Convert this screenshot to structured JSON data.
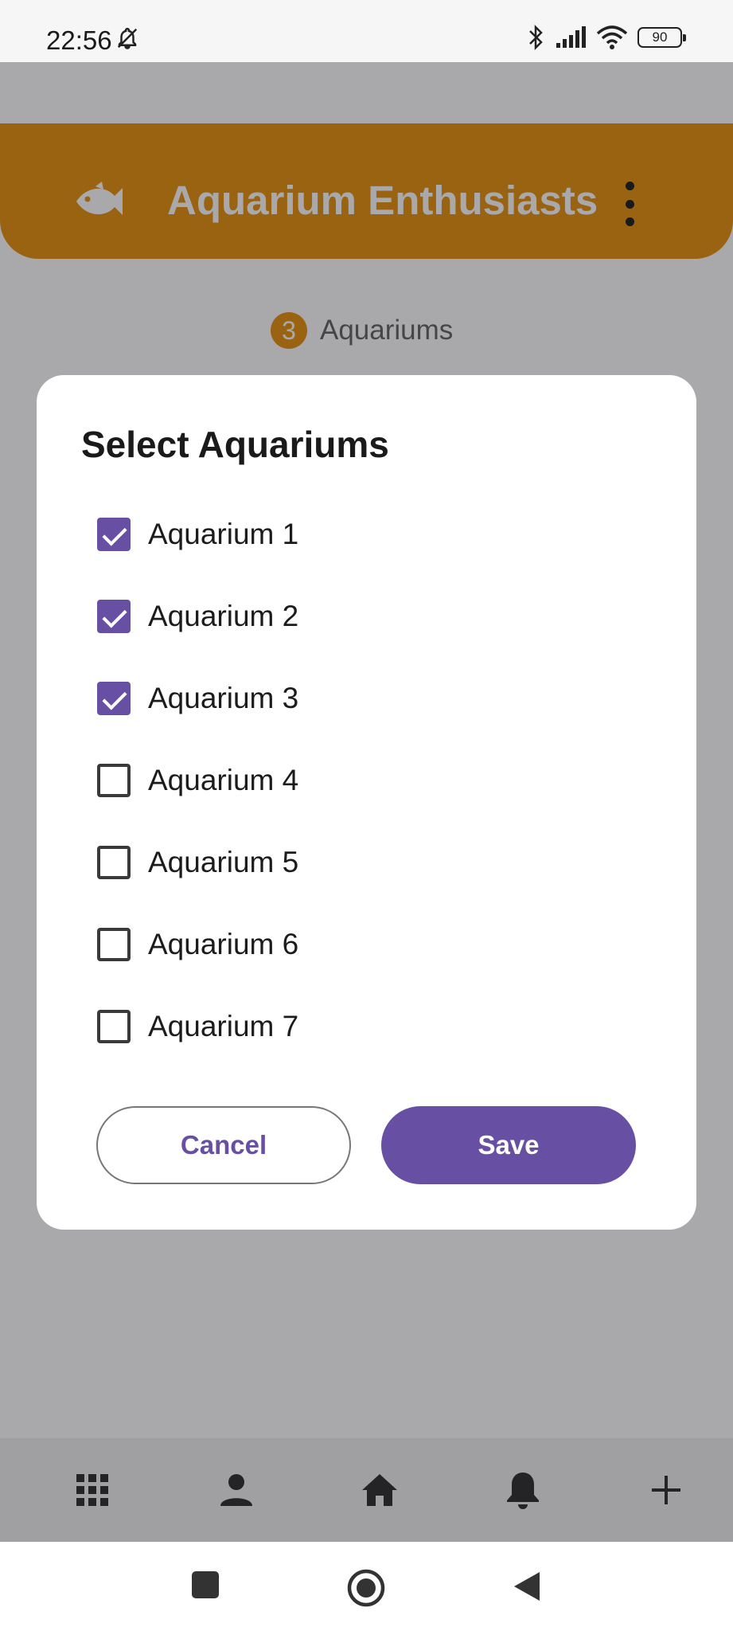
{
  "status_bar": {
    "time": "22:56",
    "battery": "90",
    "icons": [
      "bell-off-icon",
      "bluetooth-icon",
      "signal-icon",
      "wifi-icon",
      "battery-icon"
    ]
  },
  "header": {
    "title": "Aquarium Enthusiasts",
    "icon": "fish-icon",
    "menu_icon": "more-vert-icon",
    "color": "#e78a00"
  },
  "summary": {
    "count": "3",
    "label": "Aquariums"
  },
  "dialog": {
    "title": "Select Aquariums",
    "options": [
      {
        "label": "Aquarium 1",
        "checked": true
      },
      {
        "label": "Aquarium 2",
        "checked": true
      },
      {
        "label": "Aquarium 3",
        "checked": true
      },
      {
        "label": "Aquarium 4",
        "checked": false
      },
      {
        "label": "Aquarium 5",
        "checked": false
      },
      {
        "label": "Aquarium 6",
        "checked": false
      },
      {
        "label": "Aquarium 7",
        "checked": false
      }
    ],
    "cancel_label": "Cancel",
    "save_label": "Save",
    "accent_color": "#6750a4"
  },
  "bottom_nav": {
    "items": [
      "grid-icon",
      "person-icon",
      "home-icon",
      "bell-icon",
      "add-icon"
    ]
  },
  "system_nav": {
    "items": [
      "recents-square-icon",
      "home-circle-icon",
      "back-triangle-icon"
    ]
  }
}
